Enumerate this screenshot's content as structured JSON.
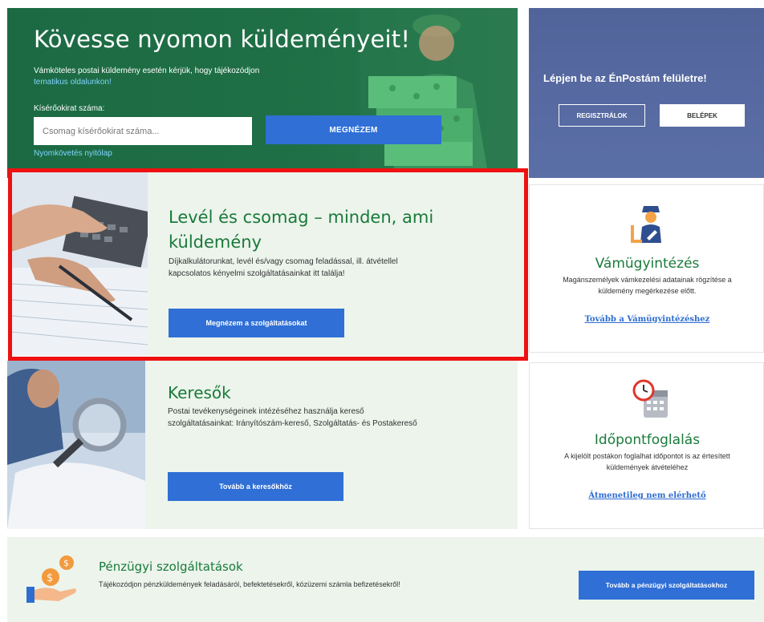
{
  "tracking": {
    "title": "Kövesse nyomon küldeményeit!",
    "notice": "Vámköteles postai küldemény esetén kérjük, hogy tájékozódjon",
    "notice_link": "tematikus oldalunkon!",
    "field_label": "Kísérőokirat száma:",
    "input_placeholder": "Csomag kísérőokirat száma...",
    "button_label": "MEGNÉZEM",
    "home_link": "Nyomkövetés nyitólap"
  },
  "login": {
    "title": "Lépjen be az ÉnPostám felületre!",
    "register_label": "REGISZTRÁLOK",
    "login_label": "BELÉPEK"
  },
  "services_card": {
    "title": "Levél és csomag – minden, ami küldemény",
    "description": "Díjkalkulátorunkat, levél és/vagy csomag feladással, ill. átvétellel kapcsolatos kényelmi szolgáltatásainkat itt találja!",
    "button_label": "Megnézem a szolgáltatásokat"
  },
  "search_card": {
    "title": "Keresők",
    "description": "Postai tevékenységeinek intézéséhez használja kereső szolgáltatásainkat: Irányítószám-kereső, Szolgáltatás- és Postakereső",
    "button_label": "Tovább a keresőkhöz"
  },
  "customs": {
    "title": "Vámügyintézés",
    "description": "Magánszemélyek vámkezelési adatainak rögzítése a küldemény megérkezése előtt.",
    "link": "Tovább a Vámügyintézéshez"
  },
  "booking": {
    "title": "Időpontfoglalás",
    "description": "A kijelölt postákon foglalhat időpontot is az értesített küldemények átvételéhez",
    "link": "Átmenetileg nem elérhető"
  },
  "finance": {
    "title": "Pénzügyi szolgáltatások",
    "description": "Tájékozódjon pénzküldemények feladásáról, befektetésekről, közüzemi számla befizetésekről!",
    "button_label": "Tovább a pénzügyi szolgáltatásokhoz"
  },
  "colors": {
    "hero_green": "#1f6f46",
    "login_blue": "#56699f",
    "card_bg": "#ecf4ec",
    "title_green": "#1a7a3a",
    "button_blue": "#2f6fd6",
    "link_blue": "#2e6cd0",
    "highlight_red": "#ee1111"
  }
}
